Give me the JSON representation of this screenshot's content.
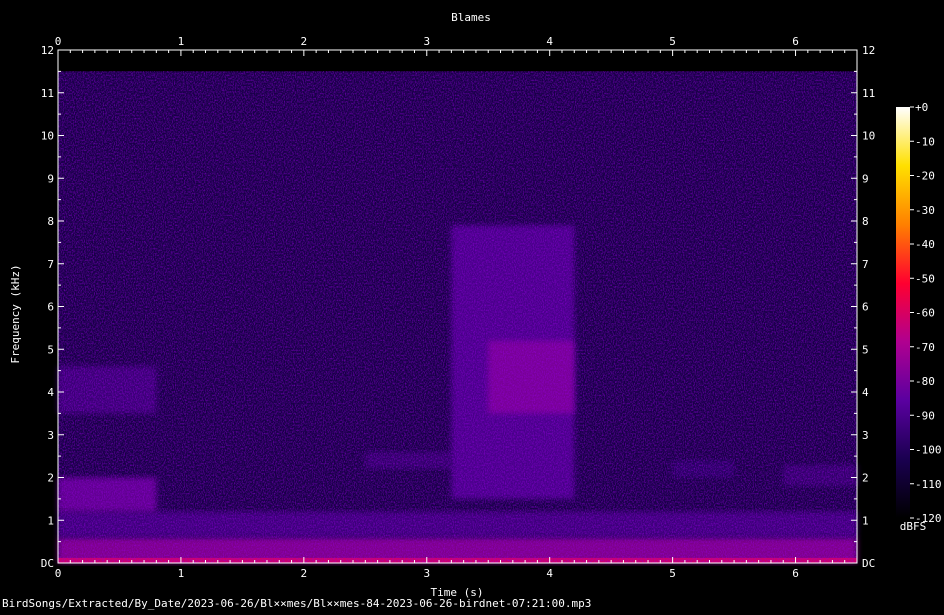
{
  "chart_data": {
    "type": "heatmap",
    "title": "Blames",
    "xlabel": "Time (s)",
    "ylabel": "Frequency (kHz)",
    "xlim": [
      0,
      6.5
    ],
    "ylim": [
      0,
      12
    ],
    "x_ticks": [
      "0",
      "1",
      "2",
      "3",
      "4",
      "5",
      "6"
    ],
    "y_ticks": [
      "DC",
      "1",
      "2",
      "3",
      "4",
      "5",
      "6",
      "7",
      "8",
      "9",
      "10",
      "11",
      "12"
    ],
    "colorbar": {
      "label": "dBFS",
      "ticks": [
        "+0",
        "-10",
        "-20",
        "-30",
        "-40",
        "-50",
        "-60",
        "-70",
        "-80",
        "-90",
        "-100",
        "-110",
        "-120"
      ],
      "range": [
        -120,
        0
      ],
      "colors": [
        "#000000",
        "#1a0050",
        "#5a00a0",
        "#b00090",
        "#ff0030",
        "#ff8000",
        "#ffe000",
        "#ffffff"
      ]
    },
    "grid": false,
    "background_level_dbfs": -105,
    "energy_regions": [
      {
        "t": [
          0.0,
          6.5
        ],
        "f": [
          0.0,
          0.6
        ],
        "dbfs": -75
      },
      {
        "t": [
          0.0,
          6.5
        ],
        "f": [
          0.6,
          1.2
        ],
        "dbfs": -92
      },
      {
        "t": [
          0.0,
          0.8
        ],
        "f": [
          1.2,
          2.0
        ],
        "dbfs": -82
      },
      {
        "t": [
          0.0,
          0.8
        ],
        "f": [
          3.5,
          4.6
        ],
        "dbfs": -93
      },
      {
        "t": [
          2.5,
          3.2
        ],
        "f": [
          2.2,
          2.6
        ],
        "dbfs": -96
      },
      {
        "t": [
          3.2,
          4.2
        ],
        "f": [
          1.5,
          7.9
        ],
        "dbfs": -88
      },
      {
        "t": [
          3.5,
          4.2
        ],
        "f": [
          3.5,
          5.2
        ],
        "dbfs": -78
      },
      {
        "t": [
          5.0,
          5.5
        ],
        "f": [
          2.0,
          2.4
        ],
        "dbfs": -98
      },
      {
        "t": [
          5.9,
          6.5
        ],
        "f": [
          1.8,
          2.3
        ],
        "dbfs": -96
      }
    ]
  },
  "footer": {
    "path": "BirdSongs/Extracted/By_Date/2023-06-26/Bl××mes/Bl××mes-84-2023-06-26-birdnet-07:21:00.mp3"
  }
}
